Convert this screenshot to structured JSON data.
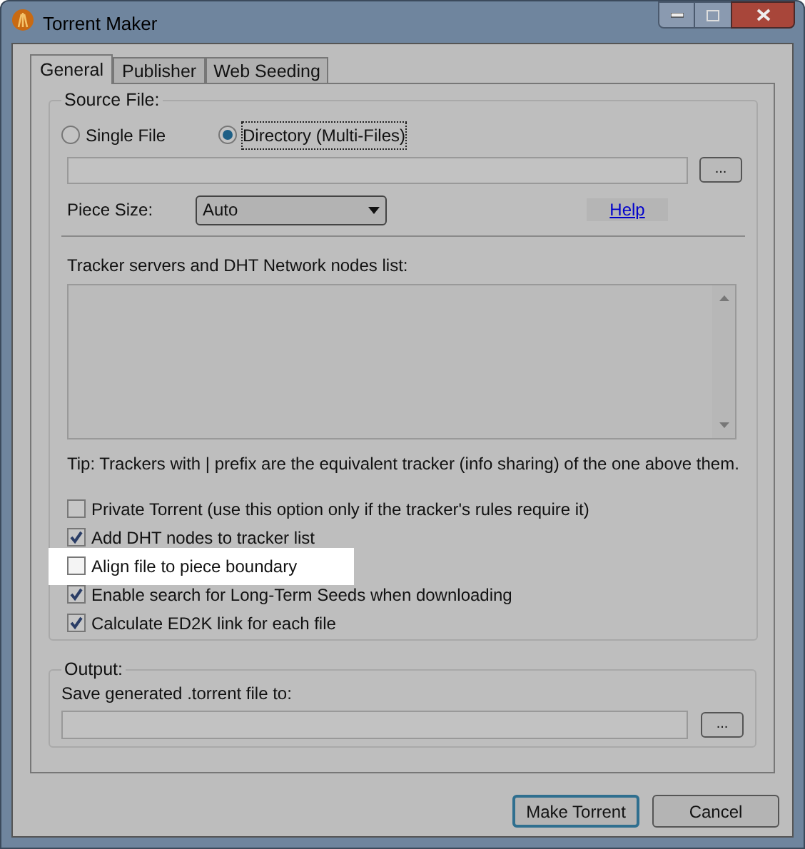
{
  "window": {
    "title": "Torrent Maker"
  },
  "tabs": [
    {
      "label": "General",
      "selected": true
    },
    {
      "label": "Publisher",
      "selected": false
    },
    {
      "label": "Web Seeding",
      "selected": false
    }
  ],
  "source_file": {
    "legend": "Source File:",
    "modes": [
      {
        "label": "Single File",
        "selected": false
      },
      {
        "label": "Directory (Multi-Files)",
        "selected": true
      }
    ],
    "browse_button": "..."
  },
  "piece_size": {
    "label": "Piece Size:",
    "value": "Auto"
  },
  "help_link": "Help",
  "trackers": {
    "label": "Tracker servers and DHT Network nodes list:"
  },
  "tip": "Tip: Trackers with | prefix are the equivalent tracker (info sharing) of the one above them.",
  "options": [
    {
      "label": "Private Torrent (use this option only if the tracker's rules require it)",
      "checked": false,
      "highlighted": false
    },
    {
      "label": "Add DHT nodes to tracker list",
      "checked": true,
      "highlighted": false
    },
    {
      "label": "Align file to piece boundary",
      "checked": false,
      "highlighted": true
    },
    {
      "label": "Enable search for Long-Term Seeds when downloading",
      "checked": true,
      "highlighted": false
    },
    {
      "label": "Calculate ED2K link for each file",
      "checked": true,
      "highlighted": false
    }
  ],
  "output": {
    "legend": "Output:",
    "label": "Save generated .torrent file to:",
    "browse_button": "..."
  },
  "buttons": [
    {
      "label": "Make Torrent",
      "default": true
    },
    {
      "label": "Cancel",
      "default": false
    }
  ]
}
